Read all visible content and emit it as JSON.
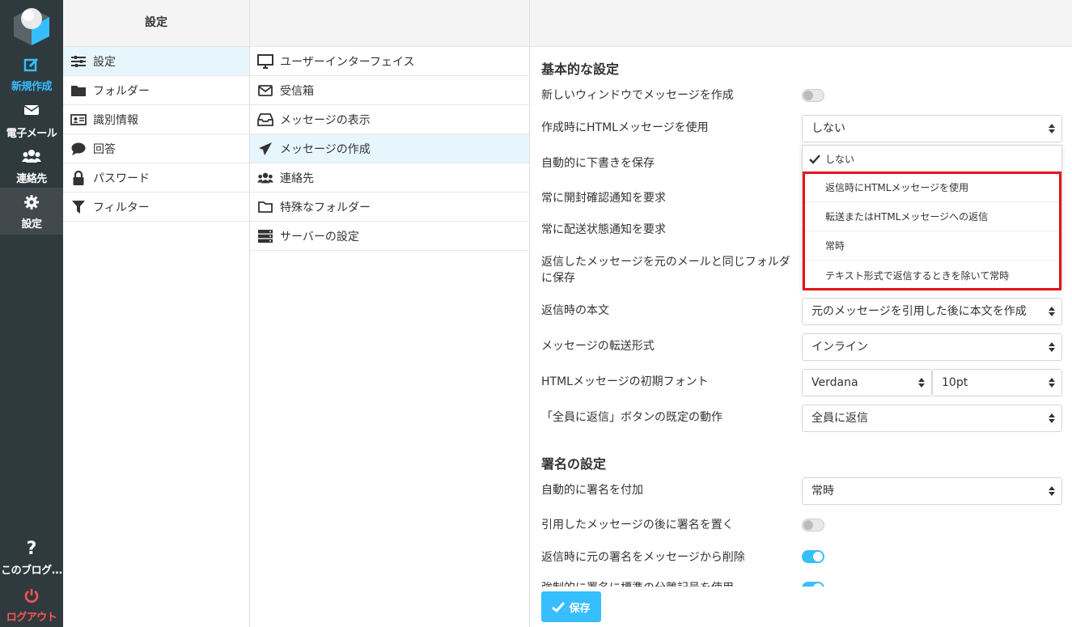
{
  "colors": {
    "rail_bg": "#2f3a3f",
    "accent": "#37beff",
    "logout": "#ff5552",
    "highlight": "#e3141b",
    "selected_row": "#e7f6fd"
  },
  "rail": {
    "compose": {
      "label": "新規作成",
      "icon": "edit-icon"
    },
    "mail": {
      "label": "電子メール",
      "icon": "envelope-icon"
    },
    "contacts": {
      "label": "連絡先",
      "icon": "users-icon"
    },
    "settings": {
      "label": "設定",
      "icon": "gear-icon"
    },
    "about": {
      "label": "このブログ...",
      "icon": "question-icon"
    },
    "logout": {
      "label": "ログアウト",
      "icon": "power-icon"
    }
  },
  "col1": {
    "header": "設定",
    "items": [
      {
        "label": "設定",
        "icon": "sliders-icon"
      },
      {
        "label": "フォルダー",
        "icon": "folder-icon"
      },
      {
        "label": "識別情報",
        "icon": "id-card-icon"
      },
      {
        "label": "回答",
        "icon": "comment-icon"
      },
      {
        "label": "パスワード",
        "icon": "lock-icon"
      },
      {
        "label": "フィルター",
        "icon": "filter-icon"
      }
    ]
  },
  "col2": {
    "items": [
      {
        "label": "ユーザーインターフェイス",
        "icon": "monitor-icon"
      },
      {
        "label": "受信箱",
        "icon": "envelope-outline-icon"
      },
      {
        "label": "メッセージの表示",
        "icon": "inbox-icon"
      },
      {
        "label": "メッセージの作成",
        "icon": "paper-plane-icon"
      },
      {
        "label": "連絡先",
        "icon": "users-icon"
      },
      {
        "label": "特殊なフォルダー",
        "icon": "folder-outline-icon"
      },
      {
        "label": "サーバーの設定",
        "icon": "server-icon"
      }
    ]
  },
  "main": {
    "section_basic": "基本的な設定",
    "rows": {
      "new_window": "新しいウィンドウでメッセージを作成",
      "html_compose": "作成時にHTMLメッセージを使用",
      "autosave": "自動的に下書きを保存",
      "read_receipt": "常に開封確認通知を要求",
      "delivery_status": "常に配送状態通知を要求",
      "save_reply": "返信したメッセージを元のメールと同じフォルダに保存",
      "reply_body": "返信時の本文",
      "forward_format": "メッセージの転送形式",
      "html_font": "HTMLメッセージの初期フォント",
      "reply_all": "「全員に返信」ボタンの既定の動作"
    },
    "values": {
      "html_compose": "しない",
      "reply_body": "元のメッセージを引用した後に本文を作成",
      "forward_format": "インライン",
      "font_family": "Verdana",
      "font_size": "10pt",
      "reply_all": "全員に返信",
      "signature_auto": "常時"
    },
    "toggles": {
      "new_window": false,
      "sig_below_quote": false,
      "strip_sig": true,
      "force_std_sep": true
    },
    "dropdown": {
      "options": [
        "しない",
        "返信時にHTMLメッセージを使用",
        "転送またはHTMLメッセージへの返信",
        "常時",
        "テキスト形式で返信するときを除いて常時"
      ],
      "selected": "しない"
    },
    "section_signature": "署名の設定",
    "sig_rows": {
      "auto_add": "自動的に署名を付加",
      "below_quote": "引用したメッセージの後に署名を置く",
      "strip": "返信時に元の署名をメッセージから削除",
      "force_sep": "強制的に署名に標準の分離記号を使用"
    },
    "save_label": "保存"
  }
}
